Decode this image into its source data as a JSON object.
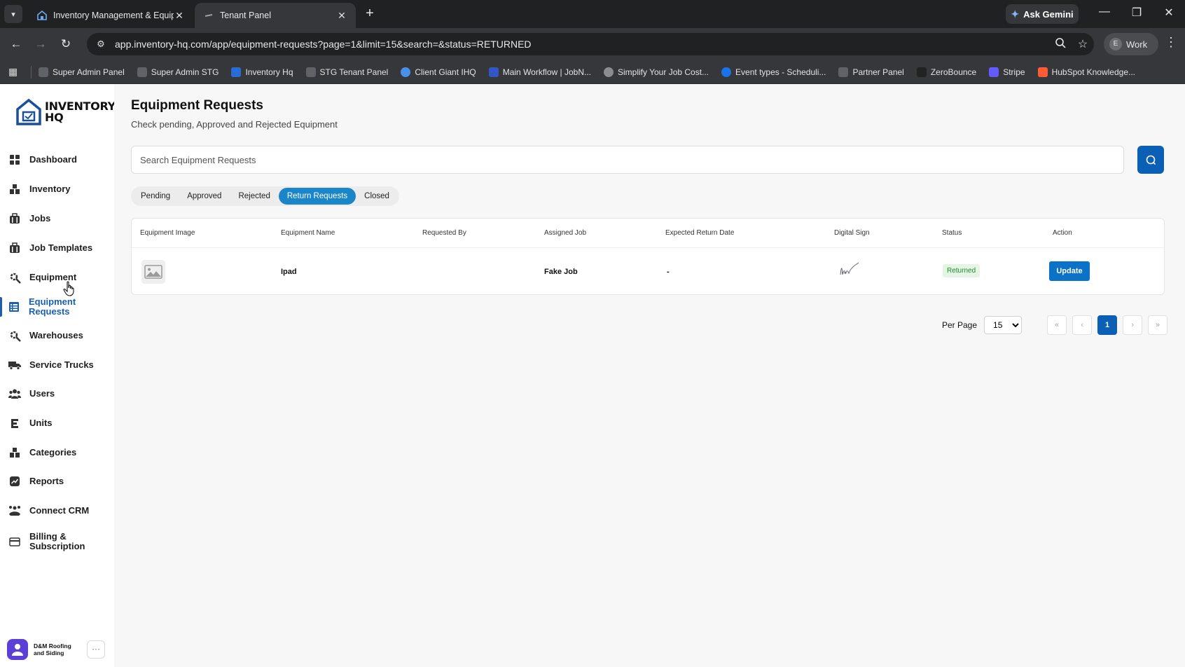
{
  "browser": {
    "tabs": [
      {
        "label": "Inventory Management & Equipm",
        "active": false
      },
      {
        "label": "Tenant Panel",
        "active": true
      }
    ],
    "url": "app.inventory-hq.com/app/equipment-requests?page=1&limit=15&search=&status=RETURNED",
    "gemini_label": "Ask Gemini",
    "profile_label": "Work",
    "profile_initial": "E",
    "bookmarks": [
      "Super Admin Panel",
      "Super Admin STG",
      "Inventory Hq",
      "STG Tenant Panel",
      "Client Giant IHQ",
      "Main Workflow | JobN...",
      "Simplify Your Job Cost...",
      "Event types - Scheduli...",
      "Partner Panel",
      "ZeroBounce",
      "Stripe",
      "HubSpot Knowledge..."
    ]
  },
  "app": {
    "logo_line1": "INVENTORY",
    "logo_line2": "HQ",
    "sidebar": [
      {
        "label": "Dashboard",
        "icon": "dashboard-icon"
      },
      {
        "label": "Inventory",
        "icon": "inventory-icon"
      },
      {
        "label": "Jobs",
        "icon": "jobs-icon"
      },
      {
        "label": "Job Templates",
        "icon": "job-templates-icon"
      },
      {
        "label": "Equipment",
        "icon": "equipment-icon"
      },
      {
        "label": "Equipment Requests",
        "icon": "equipment-requests-icon",
        "active": true
      },
      {
        "label": "Warehouses",
        "icon": "warehouses-icon"
      },
      {
        "label": "Service Trucks",
        "icon": "truck-icon"
      },
      {
        "label": "Users",
        "icon": "users-icon"
      },
      {
        "label": "Units",
        "icon": "units-icon"
      },
      {
        "label": "Categories",
        "icon": "categories-icon"
      },
      {
        "label": "Reports",
        "icon": "reports-icon"
      },
      {
        "label": "Connect CRM",
        "icon": "crm-icon"
      },
      {
        "label": "Billing & Subscription",
        "icon": "billing-icon"
      }
    ],
    "account_name": "D&M Roofing and Siding",
    "account_more": "···"
  },
  "page": {
    "title": "Equipment Requests",
    "subtitle": "Check pending, Approved and Rejected Equipment",
    "search_placeholder": "Search Equipment Requests",
    "tabs": [
      "Pending",
      "Approved",
      "Rejected",
      "Return Requests",
      "Closed"
    ],
    "active_tab": "Return Requests",
    "table": {
      "headers": [
        "Equipment Image",
        "Equipment Name",
        "Requested By",
        "Assigned Job",
        "Expected Return Date",
        "Digital Sign",
        "Status",
        "Action"
      ],
      "rows": [
        {
          "equipment_name": "Ipad",
          "requested_by": "",
          "assigned_job": "Fake Job",
          "expected_return_date": "-",
          "status": "Returned",
          "action": "Update"
        }
      ]
    },
    "pagination": {
      "per_page_label": "Per Page",
      "per_page_value": "15",
      "first": "«",
      "prev": "‹",
      "current": "1",
      "next": "›",
      "last": "»"
    }
  },
  "colors": {
    "primary": "#0b5fb5",
    "active_tab": "#1a86c8",
    "status_returned_bg": "#e4f5e4",
    "status_returned_text": "#1f8a2e",
    "browser_dark": "#1f2123"
  }
}
